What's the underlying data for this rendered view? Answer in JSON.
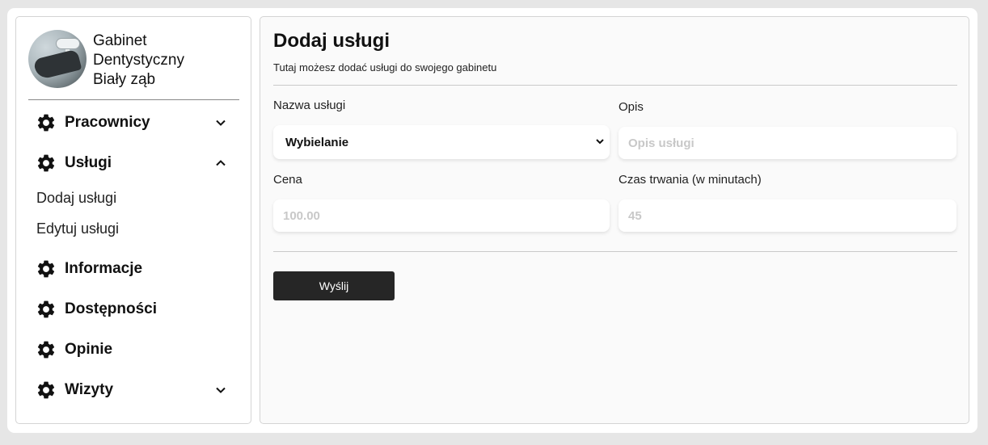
{
  "brand": {
    "name_lines": [
      "Gabinet",
      "Dentystyczny",
      "Biały ząb"
    ]
  },
  "sidebar": {
    "items": [
      {
        "label": "Pracownicy",
        "icon": "gear-icon",
        "chevron": "chevron-down-icon"
      },
      {
        "label": "Usługi",
        "icon": "gear-icon",
        "chevron": "chevron-up-icon",
        "expanded": true,
        "subitems": [
          {
            "label": "Dodaj usługi"
          },
          {
            "label": "Edytuj usługi"
          }
        ]
      },
      {
        "label": "Informacje",
        "icon": "gear-icon"
      },
      {
        "label": "Dostępności",
        "icon": "gear-icon"
      },
      {
        "label": "Opinie",
        "icon": "gear-icon"
      },
      {
        "label": "Wizyty",
        "icon": "gear-icon",
        "chevron": "chevron-down-icon"
      }
    ]
  },
  "main": {
    "title": "Dodaj usługi",
    "subtitle": "Tutaj możesz dodać usługi do swojego gabinetu",
    "form": {
      "service_name": {
        "label": "Nazwa usługi",
        "value": "Wybielanie"
      },
      "description": {
        "label": "Opis",
        "placeholder": "Opis usługi"
      },
      "price": {
        "label": "Cena",
        "placeholder": "100.00"
      },
      "duration": {
        "label": "Czas trwania (w minutach)",
        "placeholder": "45"
      },
      "submit_label": "Wyślij"
    }
  },
  "colors": {
    "page_bg": "#e6e6e6",
    "panel_bg": "#fafafa",
    "button_bg": "#262626",
    "placeholder": "#c8c8c8"
  }
}
